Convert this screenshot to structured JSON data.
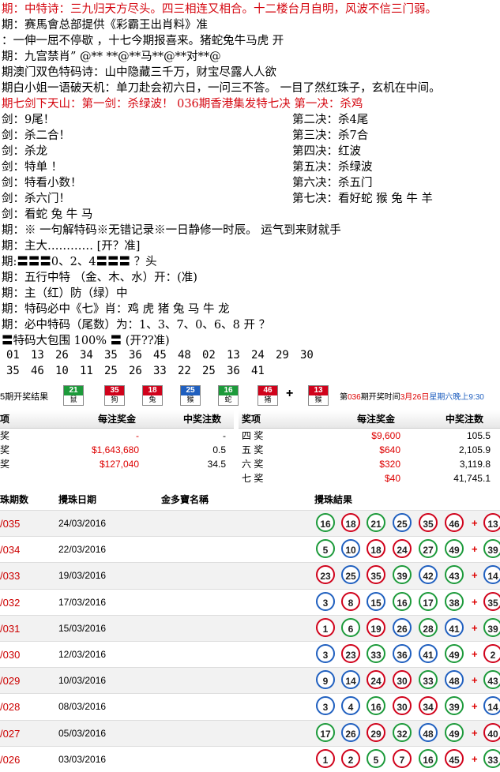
{
  "lines": [
    {
      "text": "期：中特诗：三九归天方尽头。四三相连又相合。十二楼台月自明，风波不信三门弱。",
      "cls": "red"
    },
    {
      "text": "期：赛馬會总部提供《彩霸王出肖料》准",
      "cls": ""
    },
    {
      "text": "：一伸一屈不停歇 ，十七今期报喜来。猪蛇兔牛马虎  开",
      "cls": ""
    },
    {
      "text": "期：九宫禁肖”  @** **@**马**@**对**@",
      "cls": ""
    },
    {
      "text": "期澳门双色特码诗：山中隐藏三千万，财宝尽露人人欲",
      "cls": ""
    },
    {
      "text": "期白小姐一语破天机：单刀赴会初六日，一问三不答。  一目了然红珠子，玄机在中间。",
      "cls": ""
    },
    {
      "text": "期七剑下天山：第一剑：杀绿波！        036期香港集发特七决 第一决：杀鸡",
      "cls": "red"
    }
  ],
  "swords_left": [
    "剑：9尾！",
    "剑：杀二合！",
    "剑：杀龙",
    "剑：特单 ！",
    "剑：特看小数！",
    "剑：杀六门！",
    "剑：看蛇 兔 牛 马"
  ],
  "swords_right": [
    "第二决：杀4尾",
    "第三决：杀7合",
    "第四决：红波",
    "第五决：杀绿波",
    "第六决：杀五门",
    "第七决：看好蛇 猴 兔 牛 羊"
  ],
  "lines2": [
    "期：※ 一句解特码※无错记录※一日静修一时辰。    运气到来财就手",
    "期：主大………… [开？准]",
    "期:〓〓〓0、2、4〓〓〓 ？头",
    "期：五行中特  （金、木、水）开：(准)",
    "期：主（红）防（绿）中",
    "期：特码必中《七》肖：鸡 虎 猪 兔 马 牛 龙",
    "期：必中特码（尾数）为：1、3、7、0、6、8     开 ？",
    "〓特码大包围 100% 〓  (开??准)"
  ],
  "numbers_row1": [
    "01",
    "13",
    "26",
    "34",
    "35",
    "36",
    "45",
    "48",
    "02",
    "13",
    "24",
    "29",
    "30"
  ],
  "numbers_row2": [
    "35",
    "46",
    "10",
    "11",
    "25",
    "26",
    "33",
    "22",
    "25",
    "36",
    "41"
  ],
  "strip": {
    "prefix": "5期开奖结果",
    "chips": [
      {
        "num": "21",
        "zod": "鼠",
        "color": "#1c9a3a"
      },
      {
        "num": "35",
        "zod": "狗",
        "color": "#d0021b"
      },
      {
        "num": "18",
        "zod": "兔",
        "color": "#d0021b"
      },
      {
        "num": "25",
        "zod": "猴",
        "color": "#1f5fbf"
      },
      {
        "num": "16",
        "zod": "蛇",
        "color": "#1c9a3a"
      },
      {
        "num": "46",
        "zod": "猪",
        "color": "#d0021b"
      },
      {
        "num": "13",
        "zod": "猴",
        "color": "#d0021b"
      }
    ],
    "plus": "+",
    "suffix_pre": "第",
    "suffix_num": "036",
    "suffix_mid": "期开奖时间",
    "suffix_date": "3月26日",
    "suffix_day": "星期六晚上9:30"
  },
  "prize_left": {
    "headers": [
      "项",
      "每注奖金",
      "中奖注数"
    ],
    "rows": [
      {
        "name": "奖",
        "amount": "-",
        "count": "-"
      },
      {
        "name": "奖",
        "amount": "$1,643,680",
        "count": "0.5"
      },
      {
        "name": "奖",
        "amount": "$127,040",
        "count": "34.5"
      }
    ]
  },
  "prize_right": {
    "headers": [
      "奖项",
      "每注奖金",
      "中奖注数"
    ],
    "rows": [
      {
        "name": "四 奖",
        "amount": "$9,600",
        "count": "105.5"
      },
      {
        "name": "五 奖",
        "amount": "$640",
        "count": "2,105.9"
      },
      {
        "name": "六 奖",
        "amount": "$320",
        "count": "3,119.8"
      },
      {
        "name": "七 奖",
        "amount": "$40",
        "count": "41,745.1"
      }
    ]
  },
  "draws": {
    "headers": [
      "珠期数",
      "攪珠日期",
      "金多寶名稱",
      "攪珠結果"
    ],
    "rows": [
      {
        "no": "/035",
        "date": "24/03/2016",
        "balls": [
          [
            "16",
            "green"
          ],
          [
            "18",
            "red"
          ],
          [
            "21",
            "green"
          ],
          [
            "25",
            "blue"
          ],
          [
            "35",
            "red"
          ],
          [
            "46",
            "red"
          ]
        ],
        "extra": [
          "13",
          "red"
        ]
      },
      {
        "no": "/034",
        "date": "22/03/2016",
        "balls": [
          [
            "5",
            "green"
          ],
          [
            "10",
            "blue"
          ],
          [
            "18",
            "red"
          ],
          [
            "24",
            "red"
          ],
          [
            "27",
            "green"
          ],
          [
            "49",
            "green"
          ]
        ],
        "extra": [
          "39",
          "green"
        ]
      },
      {
        "no": "/033",
        "date": "19/03/2016",
        "balls": [
          [
            "23",
            "red"
          ],
          [
            "25",
            "blue"
          ],
          [
            "35",
            "red"
          ],
          [
            "39",
            "green"
          ],
          [
            "42",
            "blue"
          ],
          [
            "43",
            "green"
          ]
        ],
        "extra": [
          "14",
          "blue"
        ]
      },
      {
        "no": "/032",
        "date": "17/03/2016",
        "balls": [
          [
            "3",
            "blue"
          ],
          [
            "8",
            "red"
          ],
          [
            "15",
            "blue"
          ],
          [
            "16",
            "green"
          ],
          [
            "17",
            "green"
          ],
          [
            "38",
            "green"
          ]
        ],
        "extra": [
          "35",
          "red"
        ]
      },
      {
        "no": "/031",
        "date": "15/03/2016",
        "balls": [
          [
            "1",
            "red"
          ],
          [
            "6",
            "green"
          ],
          [
            "19",
            "red"
          ],
          [
            "26",
            "blue"
          ],
          [
            "28",
            "green"
          ],
          [
            "41",
            "blue"
          ]
        ],
        "extra": [
          "39",
          "green"
        ]
      },
      {
        "no": "/030",
        "date": "12/03/2016",
        "balls": [
          [
            "3",
            "blue"
          ],
          [
            "23",
            "red"
          ],
          [
            "33",
            "green"
          ],
          [
            "36",
            "blue"
          ],
          [
            "41",
            "blue"
          ],
          [
            "49",
            "green"
          ]
        ],
        "extra": [
          "2",
          "red"
        ]
      },
      {
        "no": "/029",
        "date": "10/03/2016",
        "balls": [
          [
            "9",
            "blue"
          ],
          [
            "14",
            "blue"
          ],
          [
            "24",
            "red"
          ],
          [
            "30",
            "red"
          ],
          [
            "33",
            "green"
          ],
          [
            "48",
            "blue"
          ]
        ],
        "extra": [
          "43",
          "green"
        ]
      },
      {
        "no": "/028",
        "date": "08/03/2016",
        "balls": [
          [
            "3",
            "blue"
          ],
          [
            "4",
            "blue"
          ],
          [
            "16",
            "green"
          ],
          [
            "30",
            "red"
          ],
          [
            "34",
            "red"
          ],
          [
            "39",
            "green"
          ]
        ],
        "extra": [
          "14",
          "blue"
        ]
      },
      {
        "no": "/027",
        "date": "05/03/2016",
        "balls": [
          [
            "17",
            "green"
          ],
          [
            "26",
            "blue"
          ],
          [
            "29",
            "red"
          ],
          [
            "32",
            "green"
          ],
          [
            "48",
            "blue"
          ],
          [
            "49",
            "green"
          ]
        ],
        "extra": [
          "40",
          "red"
        ]
      },
      {
        "no": "/026",
        "date": "03/03/2016",
        "balls": [
          [
            "1",
            "red"
          ],
          [
            "2",
            "red"
          ],
          [
            "5",
            "green"
          ],
          [
            "7",
            "red"
          ],
          [
            "16",
            "green"
          ],
          [
            "45",
            "red"
          ]
        ],
        "extra": [
          "33",
          "green"
        ]
      }
    ]
  }
}
